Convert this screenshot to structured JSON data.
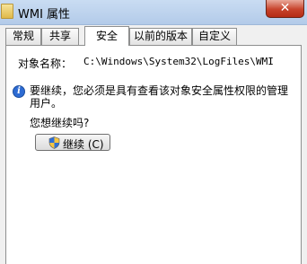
{
  "window": {
    "title": "WMI 属性",
    "close_label": "✕"
  },
  "tabs": [
    {
      "label": "常规",
      "active": false
    },
    {
      "label": "共享",
      "active": false
    },
    {
      "label": "安全",
      "active": true
    },
    {
      "label": "以前的版本",
      "active": false
    },
    {
      "label": "自定义",
      "active": false
    }
  ],
  "security": {
    "object_name_label": "对象名称：",
    "object_name_value": "C:\\Windows\\System32\\LogFiles\\WMI",
    "info_icon": "info-icon",
    "info_text": "要继续，您必须是具有查看该对象安全属性权限的管理用户。",
    "question": "您想继续吗?",
    "continue_button": "继续 (C)",
    "button_icon": "uac-shield-icon"
  }
}
